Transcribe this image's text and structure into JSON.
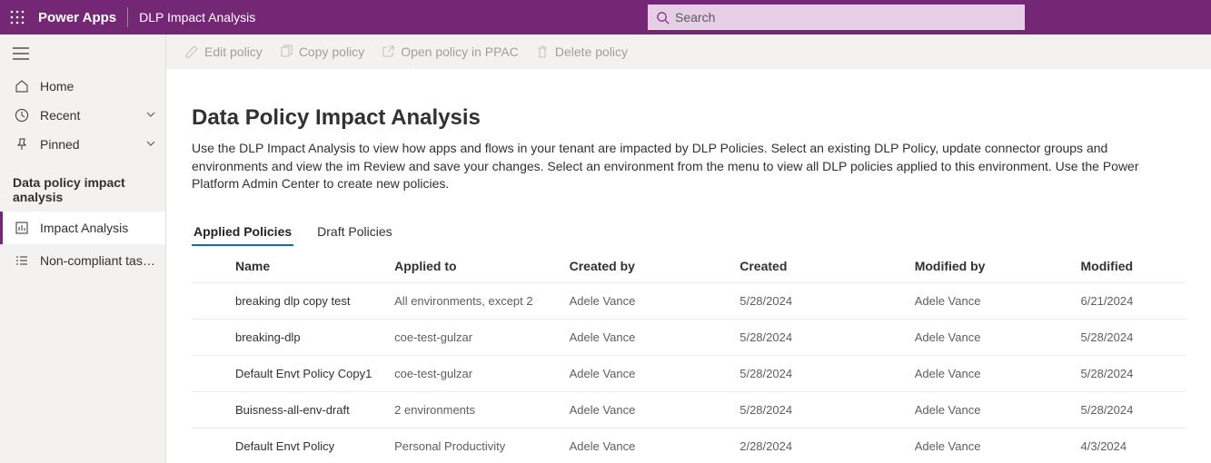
{
  "header": {
    "brand": "Power Apps",
    "page_subtitle": "DLP Impact Analysis",
    "search_placeholder": "Search"
  },
  "sidebar": {
    "items": [
      {
        "label": "Home"
      },
      {
        "label": "Recent"
      },
      {
        "label": "Pinned"
      }
    ],
    "section_title": "Data policy impact analysis",
    "sub_items": [
      {
        "label": "Impact Analysis"
      },
      {
        "label": "Non-compliant task l..."
      }
    ]
  },
  "command_bar": {
    "edit": "Edit policy",
    "copy": "Copy policy",
    "open": "Open policy in PPAC",
    "delete": "Delete policy"
  },
  "page": {
    "title": "Data Policy Impact Analysis",
    "description": "Use the DLP Impact Analysis to view how apps and flows in your tenant are impacted by DLP Policies. Select an existing DLP Policy, update connector groups and environments and view the im Review and save your changes. Select an environment from the menu to view all DLP policies applied to this environment. Use the Power Platform Admin Center to create new policies.",
    "tabs": {
      "applied": "Applied Policies",
      "draft": "Draft Policies"
    },
    "columns": {
      "name": "Name",
      "applied_to": "Applied to",
      "created_by": "Created by",
      "created": "Created",
      "modified_by": "Modified by",
      "modified": "Modified"
    },
    "rows": [
      {
        "name": "breaking dlp copy test",
        "applied_to": "All environments, except 2",
        "created_by": "Adele Vance",
        "created": "5/28/2024",
        "modified_by": "Adele Vance",
        "modified": "6/21/2024"
      },
      {
        "name": "breaking-dlp",
        "applied_to": "coe-test-gulzar",
        "created_by": "Adele Vance",
        "created": "5/28/2024",
        "modified_by": "Adele Vance",
        "modified": "5/28/2024"
      },
      {
        "name": "Default Envt Policy Copy1",
        "applied_to": "coe-test-gulzar",
        "created_by": "Adele Vance",
        "created": "5/28/2024",
        "modified_by": "Adele Vance",
        "modified": "5/28/2024"
      },
      {
        "name": "Buisness-all-env-draft",
        "applied_to": "2 environments",
        "created_by": "Adele Vance",
        "created": "5/28/2024",
        "modified_by": "Adele Vance",
        "modified": "5/28/2024"
      },
      {
        "name": "Default Envt Policy",
        "applied_to": "Personal Productivity",
        "created_by": "Adele Vance",
        "created": "2/28/2024",
        "modified_by": "Adele Vance",
        "modified": "4/3/2024"
      }
    ]
  }
}
